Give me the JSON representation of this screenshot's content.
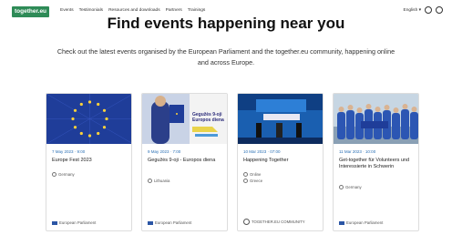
{
  "header": {
    "logo": "together.eu",
    "nav": [
      "Events",
      "Testimonials",
      "Resources and downloads",
      "Partners",
      "Trainings"
    ],
    "language": "English",
    "language_chevron": "▾"
  },
  "hero": {
    "title": "Find events happening near you",
    "subtitle": "Check out the latest events organised by the European Parliament and the together.eu community, happening online and across Europe."
  },
  "events": [
    {
      "date": "7 May 2023 · 9:00",
      "title": "Europe Fest 2023",
      "locations": [
        "Germany"
      ],
      "organiser": "European Parliament",
      "thumb": "eu-flag"
    },
    {
      "date": "9 May 2023 · 7:00",
      "title": "Gegužės 9-oji - Europos diena",
      "locations": [
        "Lithuania"
      ],
      "organiser": "European Parliament",
      "thumb": "europos-diena"
    },
    {
      "date": "10 Mar 2023 · 07:00",
      "title": "Happening Together",
      "locations": [
        "Online",
        "Greece"
      ],
      "organiser": "TOGETHER.EU COMMUNITY",
      "thumb": "conference"
    },
    {
      "date": "11 Mar 2023 · 10:00",
      "title": "Get-together für Volunteers und Interessierte in Schwerin",
      "locations": [
        "Germany"
      ],
      "organiser": "European Parliament",
      "thumb": "group"
    }
  ]
}
